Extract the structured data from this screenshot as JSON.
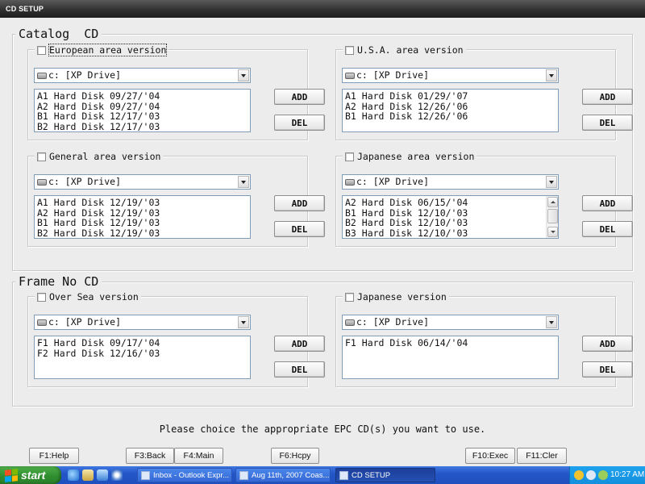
{
  "window": {
    "title": "CD SETUP"
  },
  "groups": {
    "catalog": {
      "title": "Catalog  CD",
      "panels": [
        {
          "label": "European area version",
          "drive": "c: [XP Drive]",
          "items": [
            "A1 Hard Disk 09/27/'04",
            "A2 Hard Disk 09/27/'04",
            "B1 Hard Disk 12/17/'03",
            "B2 Hard Disk 12/17/'03"
          ],
          "add": "ADD",
          "del": "DEL"
        },
        {
          "label": "U.S.A. area version",
          "drive": "c: [XP Drive]",
          "items": [
            "A1 Hard Disk 01/29/'07",
            "A2 Hard Disk 12/26/'06",
            "B1 Hard Disk 12/26/'06"
          ],
          "add": "ADD",
          "del": "DEL"
        },
        {
          "label": "General area version",
          "drive": "c: [XP Drive]",
          "items": [
            "A1 Hard Disk 12/19/'03",
            "A2 Hard Disk 12/19/'03",
            "B1 Hard Disk 12/19/'03",
            "B2 Hard Disk 12/19/'03"
          ],
          "add": "ADD",
          "del": "DEL"
        },
        {
          "label": "Japanese area version",
          "drive": "c: [XP Drive]",
          "items": [
            "A2 Hard Disk 06/15/'04",
            "B1 Hard Disk 12/10/'03",
            "B2 Hard Disk 12/10/'03",
            "B3 Hard Disk 12/10/'03"
          ],
          "add": "ADD",
          "del": "DEL"
        }
      ]
    },
    "frame": {
      "title": "Frame No CD",
      "panels": [
        {
          "label": "Over Sea version",
          "drive": "c: [XP Drive]",
          "items": [
            "F1 Hard Disk 09/17/'04",
            "F2 Hard Disk 12/16/'03"
          ],
          "add": "ADD",
          "del": "DEL"
        },
        {
          "label": "Japanese version",
          "drive": "c: [XP Drive]",
          "items": [
            "F1 Hard Disk 06/14/'04"
          ],
          "add": "ADD",
          "del": "DEL"
        }
      ]
    }
  },
  "message": "Please choice the appropriate EPC CD(s) you want to use.",
  "function_keys": {
    "f1": "F1:Help",
    "f3": "F3:Back",
    "f4": "F4:Main",
    "f6": "F6:Hcpy",
    "f10": "F10:Exec",
    "f11": "F11:Cler"
  },
  "taskbar": {
    "start": "start",
    "items": [
      "Inbox - Outlook Expr...",
      "Aug 11th, 2007 Coas...",
      "CD SETUP"
    ],
    "clock": "10:27 AM"
  }
}
